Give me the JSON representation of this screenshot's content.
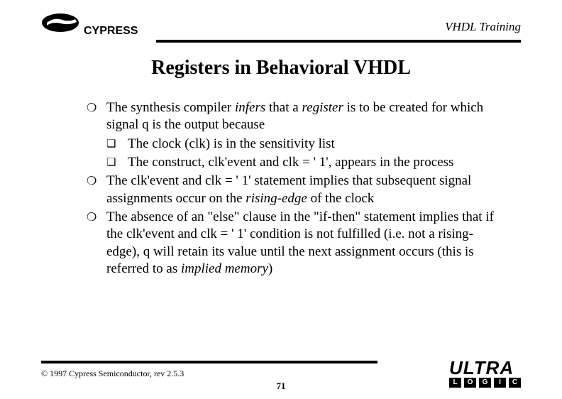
{
  "header": {
    "brand": "CYPRESS",
    "title": "VHDL Training"
  },
  "slide_title": "Registers in Behavioral VHDL",
  "bullets": {
    "b1_pre": "The synthesis compiler ",
    "b1_em1": "infers",
    "b1_mid": " that a ",
    "b1_em2": "register",
    "b1_post": " is to be created for which signal q is the output because",
    "s1": "The clock (clk) is in the sensitivity list",
    "s2": "The construct, clk'event and clk = ' 1', appears in the process",
    "b2_pre": "The clk'event and clk = ' 1' statement implies that subsequent signal assignments occur on the ",
    "b2_em": "rising-edge",
    "b2_post": " of the clock",
    "b3_pre": "The absence of an \"else\" clause in the \"if-then\" statement implies that if the clk'event and clk = ' 1' condition is not fulfilled (i.e. not a rising-edge), q will retain its value until the next assignment occurs (this is referred to as ",
    "b3_em": "implied memory",
    "b3_post": ")"
  },
  "footer": {
    "copyright": "© 1997 Cypress Semiconductor, rev 2.5.3",
    "page": "71",
    "ultra": "ULTRA",
    "boxes": {
      "l": "L",
      "o": "O",
      "g": "G",
      "i": "I",
      "c": "C"
    }
  }
}
